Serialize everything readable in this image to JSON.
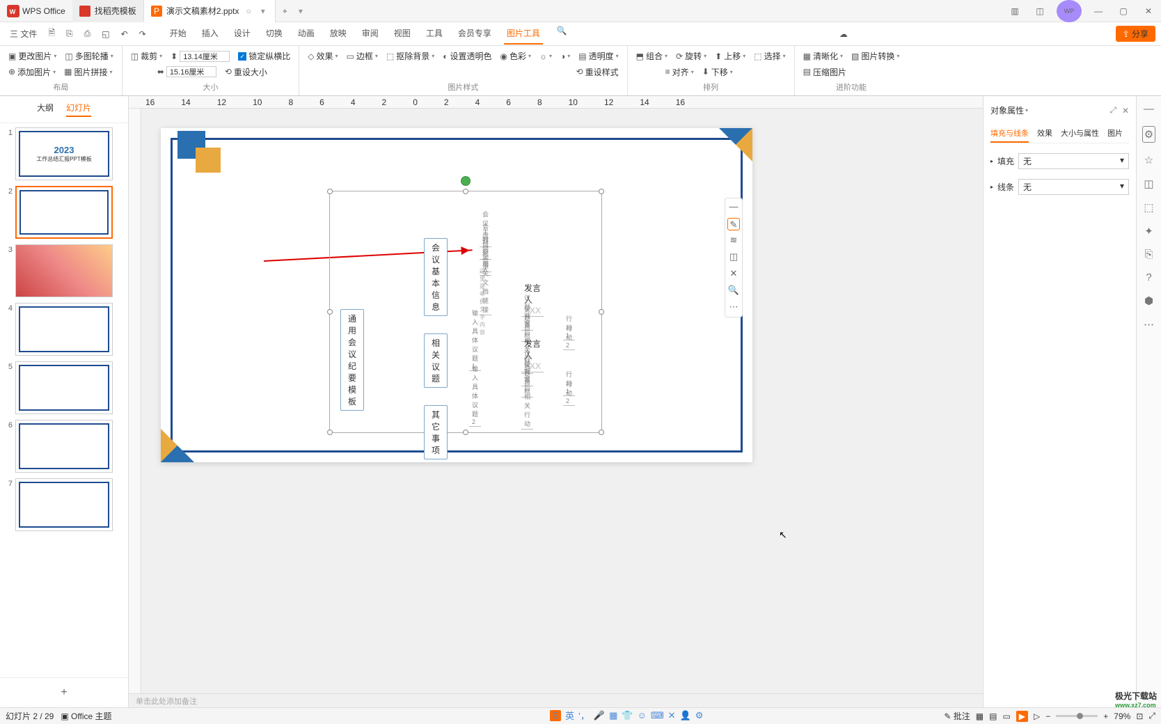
{
  "titlebar": {
    "app": "WPS Office",
    "tab1": "找稻壳模板",
    "tab2": "演示文稿素材2.pptx"
  },
  "menubar": {
    "file": "三 文件",
    "tabs": [
      "开始",
      "插入",
      "设计",
      "切换",
      "动画",
      "放映",
      "审阅",
      "视图",
      "工具",
      "会员专享",
      "图片工具"
    ],
    "share": "分享"
  },
  "ribbon": {
    "layout": {
      "change": "更改图片",
      "multi": "多图轮播",
      "add": "添加图片",
      "merge": "图片拼接",
      "label": "布局"
    },
    "size": {
      "crop": "裁剪",
      "h": "13.14厘米",
      "w": "15.16厘米",
      "lock": "锁定纵横比",
      "reset": "重设大小",
      "label": "大小"
    },
    "style": {
      "fx": "效果",
      "border": "边框",
      "bg": "抠除背景",
      "trans_set": "设置透明色",
      "color": "色彩",
      "trans": "透明度",
      "reset": "重设样式",
      "label": "图片样式"
    },
    "arrange": {
      "combine": "组合",
      "rotate": "旋转",
      "align": "对齐",
      "up": "上移",
      "down": "下移",
      "sel": "选择",
      "label": "排列"
    },
    "advanced": {
      "sharp": "清晰化",
      "compress": "压缩图片",
      "convert": "图片转换",
      "label": "进阶功能"
    }
  },
  "left": {
    "outline": "大纲",
    "slides": "幻灯片",
    "add": "+"
  },
  "thumbs": [
    "1",
    "2",
    "3",
    "4",
    "5",
    "6",
    "7"
  ],
  "thumb1": {
    "year": "2023",
    "title": "工作总结汇报PPT模板"
  },
  "slide": {
    "root": "通用会议纪要模板",
    "n1": "会议基本信息",
    "l1": "会议主题",
    "l2": "会议目标",
    "l3": "时间地点",
    "l4": "参会人",
    "l5": "相关文档链接",
    "l5b": "这里是举例文字内容",
    "n2": "相关议题",
    "t1": "输入具体议题1",
    "t2": "输入具体议题2",
    "sp": "发言人",
    "spv": "XXX",
    "bg": "议题背景",
    "goal": "议题目标",
    "act": "会后相关行动",
    "a1": "行动 1",
    "a2": "行动 2",
    "n3": "其它事项"
  },
  "notes": "单击此处添加备注",
  "rp": {
    "title": "对象属性",
    "t1": "填充与线条",
    "t2": "效果",
    "t3": "大小与属性",
    "t4": "图片",
    "fill": "填充",
    "line": "线条",
    "none": "无"
  },
  "status": {
    "page": "幻灯片 2 / 29",
    "theme": "Office 主题",
    "comment": "批注",
    "zoom": "79%",
    "ime": "英"
  },
  "watermark": {
    "t": "极光下载站",
    "u": "www.xz7.com"
  }
}
